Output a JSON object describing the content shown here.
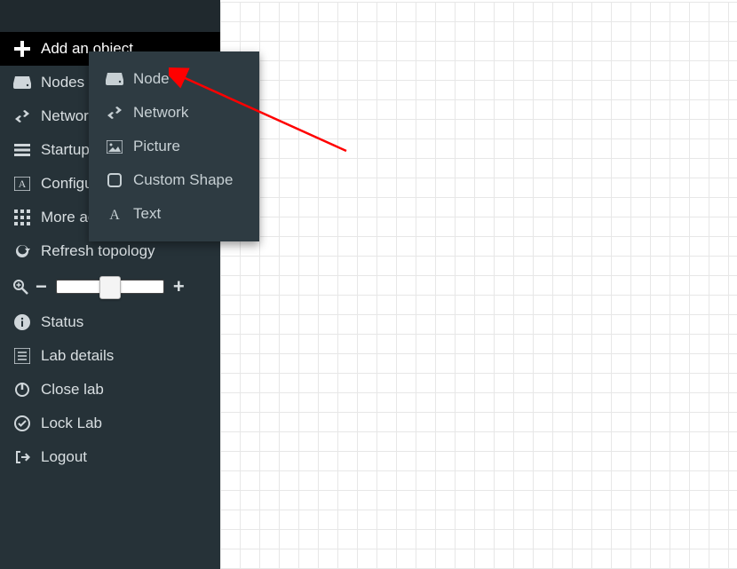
{
  "sidebar": {
    "add_object": "Add an object",
    "nodes": "Nodes",
    "networks": "Networks",
    "startup": "Startup-configs",
    "configured": "Configured objects",
    "more": "More actions",
    "refresh": "Refresh topology",
    "status": "Status",
    "lab_details": "Lab details",
    "close_lab": "Close lab",
    "lock_lab": "Lock Lab",
    "logout": "Logout"
  },
  "submenu": {
    "node": "Node",
    "network": "Network",
    "picture": "Picture",
    "custom_shape": "Custom Shape",
    "text": "Text"
  },
  "colors": {
    "sidebar_bg": "#263238",
    "submenu_bg": "#2e3b42",
    "accent_arrow": "#ff0000"
  }
}
